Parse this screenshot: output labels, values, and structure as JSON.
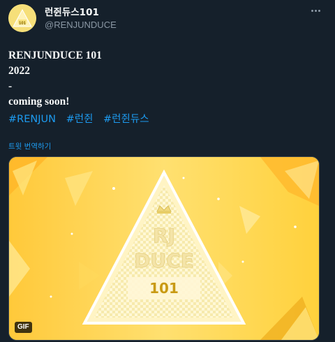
{
  "account": {
    "display_name": "런쥔듀스101",
    "handle": "@RENJUNDUCE",
    "avatar_text": "101"
  },
  "tweet": {
    "lines": [
      "RENJUNDUCE 101",
      "2022",
      "-",
      "coming soon!"
    ],
    "hashtags": [
      "#RENJUN",
      "#런쥔",
      "#런쥔듀스"
    ],
    "translate_label": "트윗 번역하기"
  },
  "media": {
    "type": "gif",
    "badge": "GIF",
    "logo_line1": "RJ",
    "logo_line2": "DUCE",
    "logo_line3": "101"
  },
  "icons": {
    "more": "more-dots-icon",
    "crown": "crown-icon"
  },
  "colors": {
    "background": "#15202b",
    "text": "#f7f9f9",
    "muted": "#8b98a5",
    "link": "#1d9bf0",
    "media_yellow": "#ffd24a"
  }
}
